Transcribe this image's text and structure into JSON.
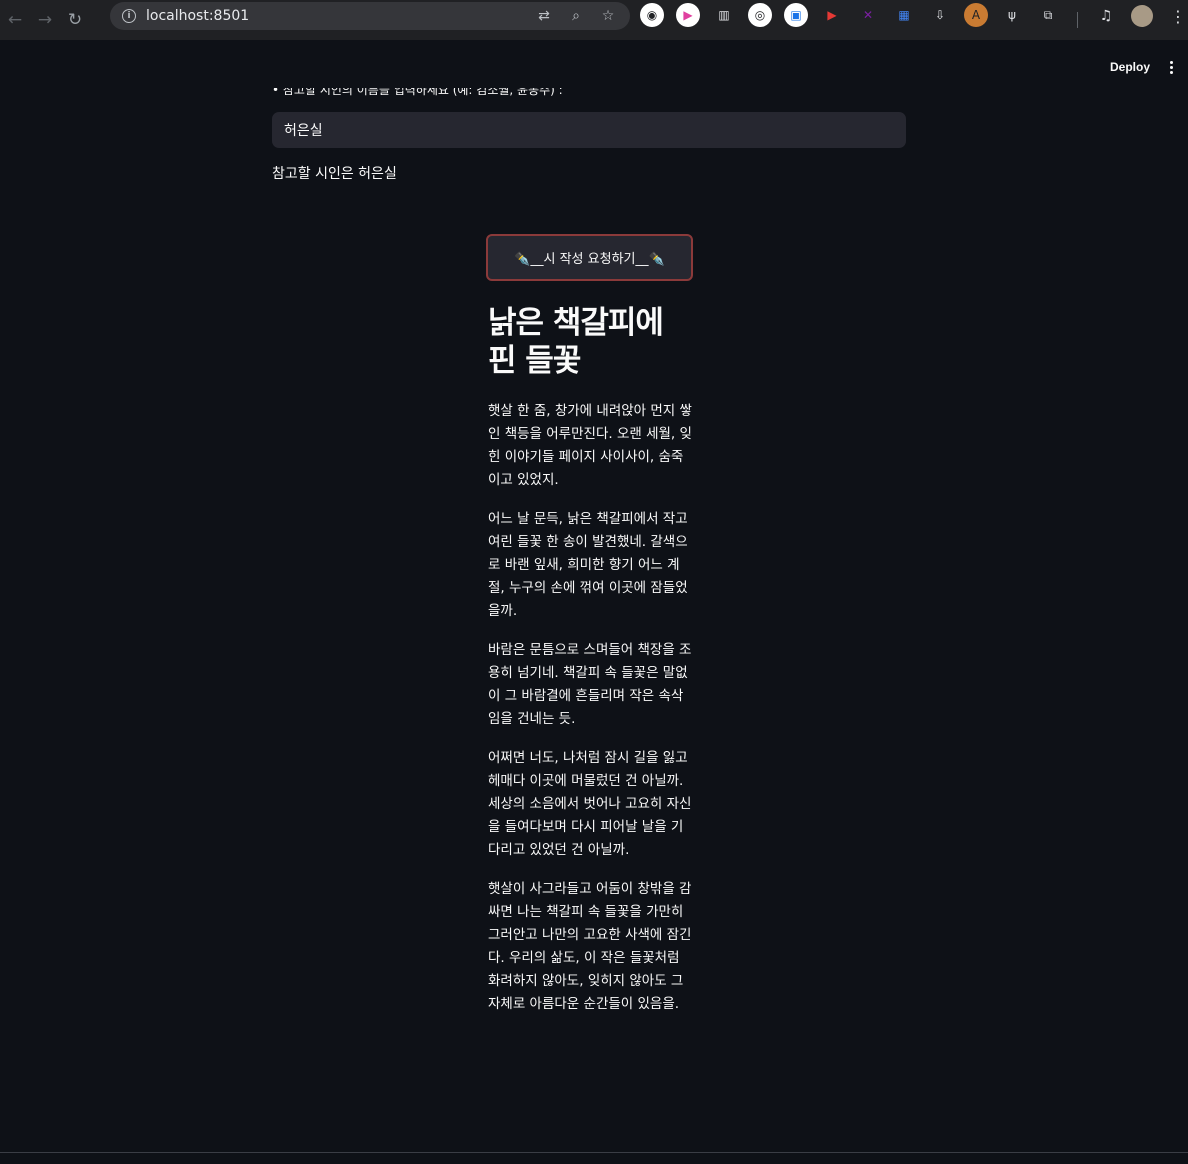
{
  "browser": {
    "url": "localhost:8501",
    "nav": {
      "back": "←",
      "forward": "→",
      "reload": "↻"
    },
    "omnibox_icons": [
      {
        "name": "translate-icon",
        "glyph": "⇄"
      },
      {
        "name": "zoom-icon",
        "glyph": "⌕"
      },
      {
        "name": "bookmark-star-icon",
        "glyph": "☆"
      }
    ],
    "extensions": [
      {
        "name": "extension-owl-icon",
        "glyph": "◉",
        "bg": "#ffffff",
        "color": "#202124"
      },
      {
        "name": "extension-play-icon",
        "glyph": "▶",
        "bg": "#ffffff",
        "color": "#e040a0"
      },
      {
        "name": "extension-reader-icon",
        "glyph": "▥",
        "bg": "transparent",
        "color": "#dfe1e5"
      },
      {
        "name": "extension-camera-icon",
        "glyph": "◎",
        "bg": "#ffffff",
        "color": "#202124"
      },
      {
        "name": "extension-doc-icon",
        "glyph": "▣",
        "bg": "#ffffff",
        "color": "#1a73e8"
      },
      {
        "name": "extension-red-play-icon",
        "glyph": "▶",
        "bg": "transparent",
        "color": "#e53935"
      },
      {
        "name": "extension-x-icon",
        "glyph": "✕",
        "bg": "transparent",
        "color": "#7b1fa2"
      },
      {
        "name": "extension-grid-icon",
        "glyph": "▦",
        "bg": "transparent",
        "color": "#4285f4"
      },
      {
        "name": "extension-download-icon",
        "glyph": "⇩",
        "bg": "transparent",
        "color": "#dfe1e5"
      },
      {
        "name": "extension-a-icon",
        "glyph": "A",
        "bg": "#c97b32",
        "color": "#202124"
      },
      {
        "name": "extension-utensils-icon",
        "glyph": "ψ",
        "bg": "transparent",
        "color": "#dfe1e5"
      },
      {
        "name": "extensions-puzzle-icon",
        "glyph": "⧉",
        "bg": "transparent",
        "color": "#dfe1e5"
      }
    ],
    "media_icon": "♫",
    "menu_icon": "⋮"
  },
  "header": {
    "deploy_label": "Deploy"
  },
  "form": {
    "label": "• 참고할 시인의 이름을 입력하세요 (예: 김소월, 윤동주) :",
    "input_value": "허은실",
    "result_text": "참고할 시인은 허은실",
    "submit_label": "✒️__시 작성 요청하기__✒️"
  },
  "poem": {
    "title": "낡은 책갈피에 핀 들꽃",
    "paragraphs": [
      "햇살 한 줌, 창가에 내려앉아 먼지 쌓인 책등을 어루만진다. 오랜 세월, 잊힌 이야기들 페이지 사이사이, 숨죽이고 있었지.",
      "어느 날 문득, 낡은 책갈피에서 작고 여린 들꽃 한 송이 발견했네. 갈색으로 바랜 잎새, 희미한 향기 어느 계절, 누구의 손에 꺾여 이곳에 잠들었을까.",
      "바람은 문틈으로 스며들어 책장을 조용히 넘기네. 책갈피 속 들꽃은 말없이 그 바람결에 흔들리며 작은 속삭임을 건네는 듯.",
      "어쩌면 너도, 나처럼 잠시 길을 잃고 헤매다 이곳에 머물렀던 건 아닐까. 세상의 소음에서 벗어나 고요히 자신을 들여다보며 다시 피어날 날을 기다리고 있었던 건 아닐까.",
      "햇살이 사그라들고 어둠이 창밖을 감싸면 나는 책갈피 속 들꽃을 가만히 그러안고 나만의 고요한 사색에 잠긴다. 우리의 삶도, 이 작은 들꽃처럼 화려하지 않아도, 잊히지 않아도 그 자체로 아름다운 순간들이 있음을."
    ]
  }
}
